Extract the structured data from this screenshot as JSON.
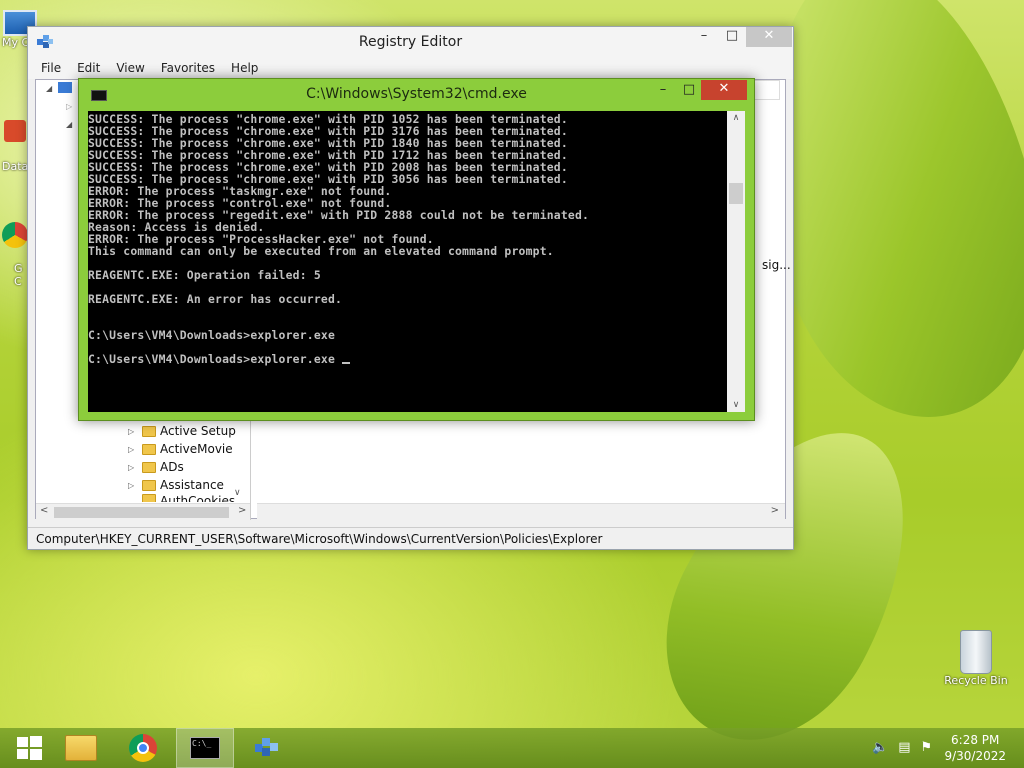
{
  "desktop": {
    "icons": [
      {
        "label": "My C"
      },
      {
        "label": "Data"
      },
      {
        "label": "G"
      },
      {
        "label": "C"
      }
    ],
    "recycle_bin": {
      "label": "Recycle Bin"
    }
  },
  "registry_editor": {
    "title": "Registry Editor",
    "menu": [
      "File",
      "Edit",
      "View",
      "Favorites",
      "Help"
    ],
    "tree_items": [
      "Active Setup",
      "ActiveMovie",
      "ADs",
      "Assistance",
      "AuthCookies"
    ],
    "right_pane_text": "sig...",
    "status_path": "Computer\\HKEY_CURRENT_USER\\Software\\Microsoft\\Windows\\CurrentVersion\\Policies\\Explorer"
  },
  "cmd": {
    "title": "C:\\Windows\\System32\\cmd.exe",
    "lines": [
      "SUCCESS: The process \"chrome.exe\" with PID 1052 has been terminated.",
      "SUCCESS: The process \"chrome.exe\" with PID 3176 has been terminated.",
      "SUCCESS: The process \"chrome.exe\" with PID 1840 has been terminated.",
      "SUCCESS: The process \"chrome.exe\" with PID 1712 has been terminated.",
      "SUCCESS: The process \"chrome.exe\" with PID 2008 has been terminated.",
      "SUCCESS: The process \"chrome.exe\" with PID 3056 has been terminated.",
      "ERROR: The process \"taskmgr.exe\" not found.",
      "ERROR: The process \"control.exe\" not found.",
      "ERROR: The process \"regedit.exe\" with PID 2888 could not be terminated.",
      "Reason: Access is denied.",
      "ERROR: The process \"ProcessHacker.exe\" not found.",
      "This command can only be executed from an elevated command prompt.",
      "",
      "REAGENTC.EXE: Operation failed: 5",
      "",
      "REAGENTC.EXE: An error has occurred.",
      "",
      "",
      "C:\\Users\\VM4\\Downloads>explorer.exe",
      "",
      "C:\\Users\\VM4\\Downloads>explorer.exe "
    ]
  },
  "taskbar": {
    "items": [
      "start-button",
      "file-explorer-icon",
      "chrome-icon",
      "cmd-icon",
      "regedit-icon"
    ],
    "time": "6:28 PM",
    "date": "9/30/2022"
  }
}
